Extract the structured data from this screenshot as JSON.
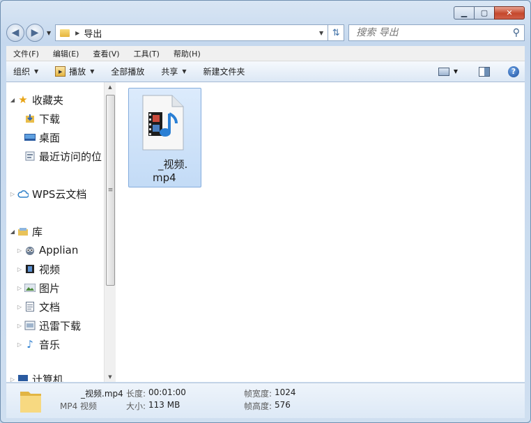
{
  "window": {
    "min": "▁",
    "max": "▢",
    "close": "✕"
  },
  "address": {
    "path": "导出"
  },
  "search": {
    "placeholder": "搜索 导出"
  },
  "menu": [
    "文件(F)",
    "编辑(E)",
    "查看(V)",
    "工具(T)",
    "帮助(H)"
  ],
  "toolbar": {
    "organize": "组织",
    "play": "播放",
    "play_all": "全部播放",
    "share": "共享",
    "new_folder": "新建文件夹"
  },
  "nav": {
    "favorites": "收藏夹",
    "downloads": "下载",
    "desktop": "桌面",
    "recent": "最近访问的位",
    "wps": "WPS云文档",
    "libraries": "库",
    "applian": "Applian",
    "videos": "视频",
    "pictures": "图片",
    "documents": "文档",
    "xunlei": "迅雷下载",
    "music": "音乐",
    "computer": "计算机"
  },
  "file": {
    "line1": "_视频.",
    "line2": "mp4"
  },
  "details": {
    "name": "_视频.mp4",
    "type": "MP4 视频",
    "length_label": "长度:",
    "length": "00:01:00",
    "size_label": "大小:",
    "size": "113 MB",
    "width_label": "帧宽度:",
    "width": "1024",
    "height_label": "帧高度:",
    "height": "576"
  }
}
